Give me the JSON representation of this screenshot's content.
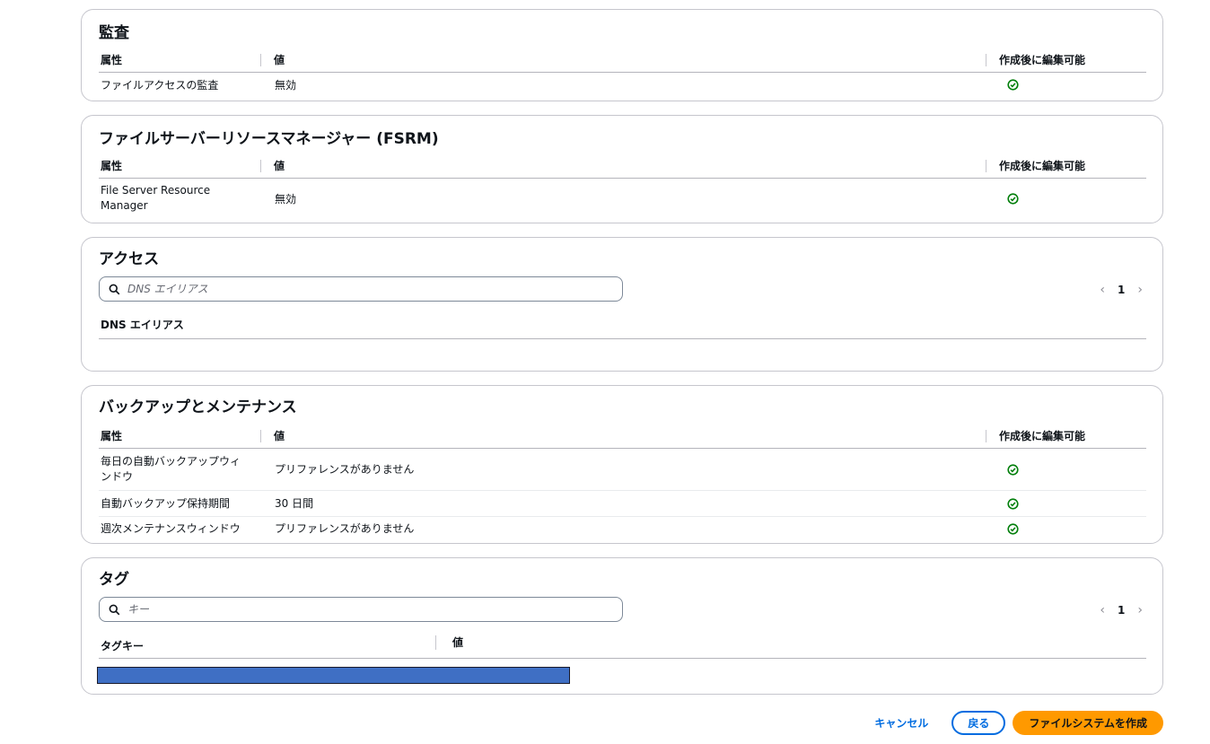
{
  "audit": {
    "title": "監査",
    "headers": {
      "attr": "属性",
      "value": "値",
      "editable": "作成後に編集可能"
    },
    "rows": [
      {
        "attr": "ファイルアクセスの監査",
        "value": "無効"
      }
    ]
  },
  "fsrm": {
    "title": "ファイルサーバーリソースマネージャー (FSRM)",
    "headers": {
      "attr": "属性",
      "value": "値",
      "editable": "作成後に編集可能"
    },
    "rows": [
      {
        "attr": "File Server Resource Manager",
        "value": "無効"
      }
    ]
  },
  "access": {
    "title": "アクセス",
    "search_placeholder": "DNS エイリアス",
    "page": "1",
    "column": "DNS エイリアス"
  },
  "backup": {
    "title": "バックアップとメンテナンス",
    "headers": {
      "attr": "属性",
      "value": "値",
      "editable": "作成後に編集可能"
    },
    "rows": [
      {
        "attr": "毎日の自動バックアップウィンドウ",
        "value": "プリファレンスがありません"
      },
      {
        "attr": "自動バックアップ保持期間",
        "value": "30 日間"
      },
      {
        "attr": "週次メンテナンスウィンドウ",
        "value": "プリファレンスがありません"
      }
    ]
  },
  "tags": {
    "title": "タグ",
    "search_placeholder": "キー",
    "page": "1",
    "headers": {
      "key": "タグキー",
      "value": "値"
    }
  },
  "footer": {
    "cancel": "キャンセル",
    "back": "戻る",
    "create": "ファイルシステムを作成"
  },
  "colors": {
    "check_green": "#037f0c",
    "primary": "#ff9900",
    "link": "#006ce0",
    "redaction": "#3f6fc4"
  },
  "icons": {
    "check": "status-positive-icon",
    "search": "search-icon"
  }
}
